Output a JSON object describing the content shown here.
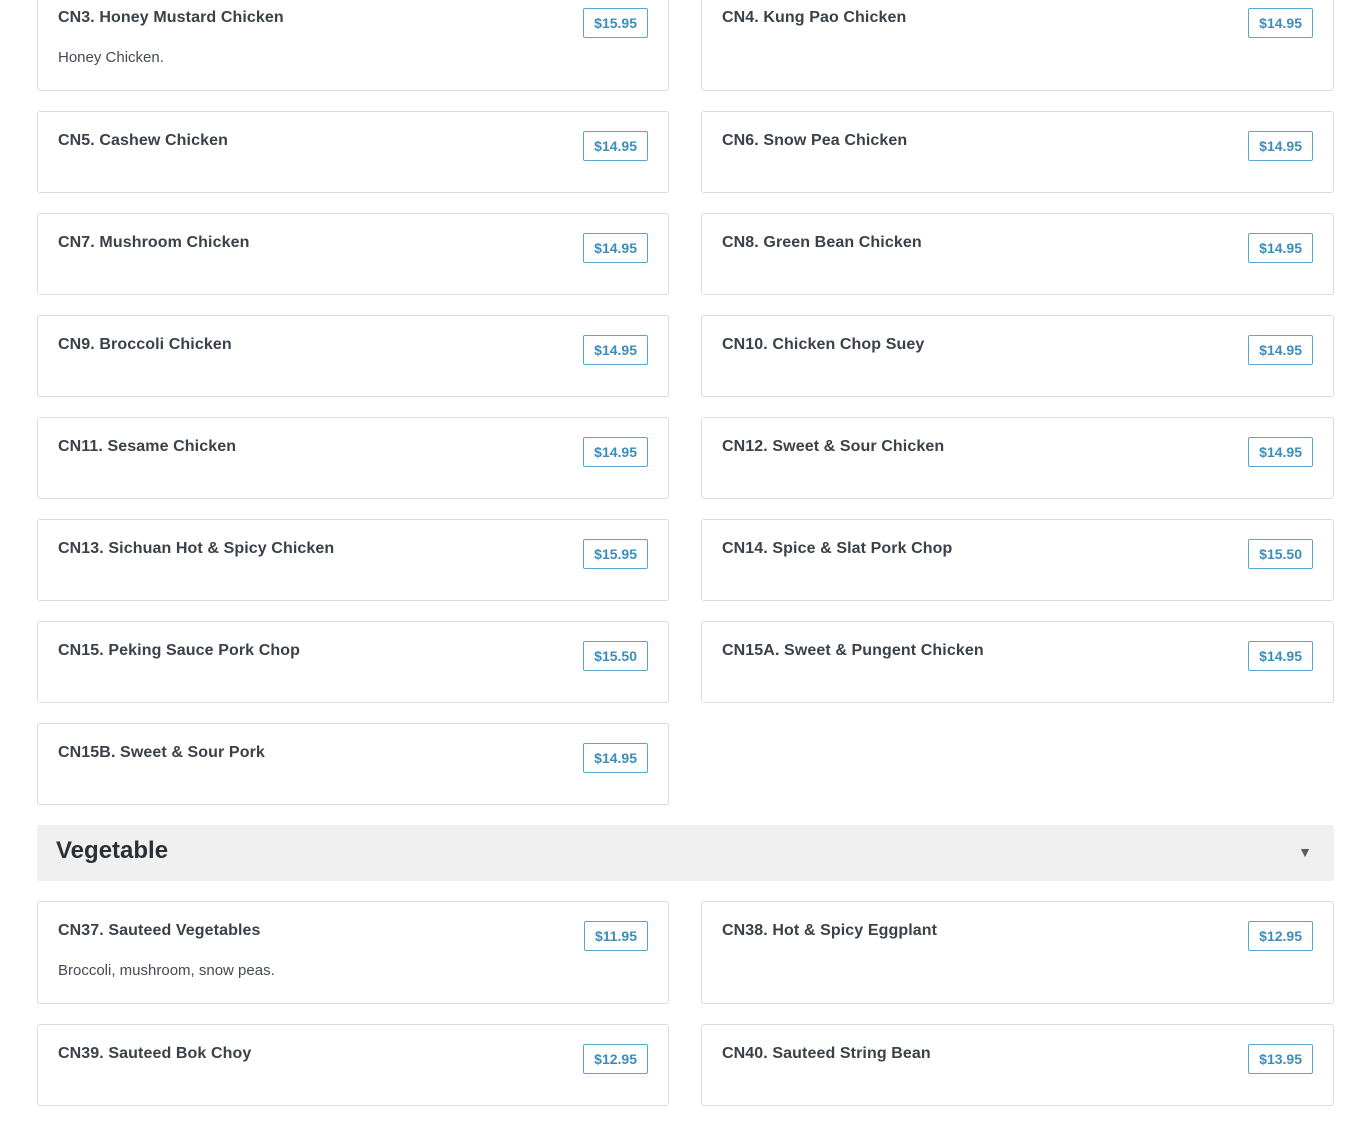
{
  "chicken_items": [
    {
      "name": "CN3. Honey Mustard Chicken",
      "price": "$15.95",
      "description": "Honey Chicken."
    },
    {
      "name": "CN4. Kung Pao Chicken",
      "price": "$14.95",
      "description": ""
    },
    {
      "name": "CN5. Cashew Chicken",
      "price": "$14.95",
      "description": ""
    },
    {
      "name": "CN6. Snow Pea Chicken",
      "price": "$14.95",
      "description": ""
    },
    {
      "name": "CN7. Mushroom Chicken",
      "price": "$14.95",
      "description": ""
    },
    {
      "name": "CN8. Green Bean Chicken",
      "price": "$14.95",
      "description": ""
    },
    {
      "name": "CN9. Broccoli Chicken",
      "price": "$14.95",
      "description": ""
    },
    {
      "name": "CN10. Chicken Chop Suey",
      "price": "$14.95",
      "description": ""
    },
    {
      "name": "CN11. Sesame Chicken",
      "price": "$14.95",
      "description": ""
    },
    {
      "name": "CN12. Sweet & Sour Chicken",
      "price": "$14.95",
      "description": ""
    },
    {
      "name": "CN13. Sichuan Hot & Spicy Chicken",
      "price": "$15.95",
      "description": ""
    },
    {
      "name": "CN14. Spice & Slat Pork Chop",
      "price": "$15.50",
      "description": ""
    },
    {
      "name": "CN15. Peking Sauce Pork Chop",
      "price": "$15.50",
      "description": ""
    },
    {
      "name": "CN15A. Sweet & Pungent Chicken",
      "price": "$14.95",
      "description": ""
    },
    {
      "name": "CN15B. Sweet & Sour Pork",
      "price": "$14.95",
      "description": ""
    }
  ],
  "vegetable_section": {
    "title": "Vegetable",
    "chevron": "▼"
  },
  "vegetable_items": [
    {
      "name": "CN37. Sauteed Vegetables",
      "price": "$11.95",
      "description": "Broccoli, mushroom, snow peas."
    },
    {
      "name": "CN38. Hot & Spicy Eggplant",
      "price": "$12.95",
      "description": ""
    },
    {
      "name": "CN39. Sauteed Bok Choy",
      "price": "$12.95",
      "description": ""
    },
    {
      "name": "CN40. Sauteed String Bean",
      "price": "$13.95",
      "description": ""
    }
  ],
  "colors": {
    "price_accent": "#3c8dbc",
    "section_header_bg": "#f0f0f0",
    "card_border": "#dcdcdc"
  }
}
